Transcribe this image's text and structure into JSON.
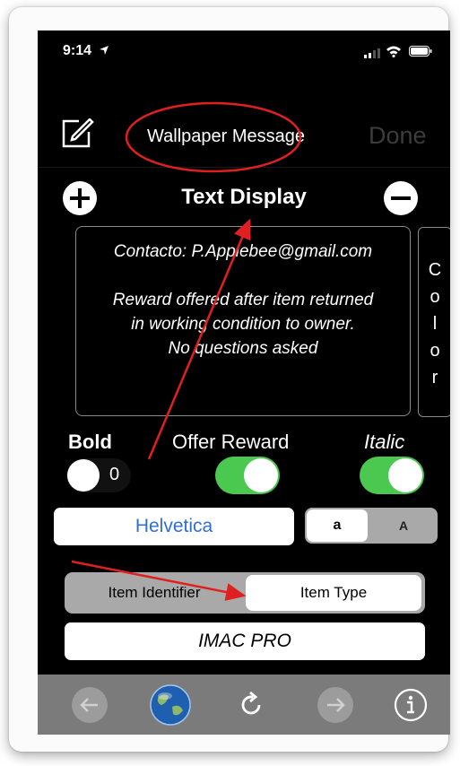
{
  "status_bar": {
    "time": "9:14"
  },
  "nav": {
    "title": "Wallpaper Message",
    "done_label": "Done"
  },
  "section": {
    "title": "Text Display"
  },
  "message": {
    "lines": [
      "Contacto: P.Applebee@gmail.com",
      "",
      "Reward offered after item returned",
      "in working condition to owner.",
      "No questions asked"
    ]
  },
  "color_button": {
    "letters": [
      "C",
      "o",
      "l",
      "o",
      "r"
    ]
  },
  "labels": {
    "bold": "Bold",
    "offer_reward": "Offer Reward",
    "italic": "Italic"
  },
  "bold_toggle": {
    "value": "0",
    "on": false
  },
  "reward_toggle": {
    "on": true
  },
  "italic_toggle": {
    "on": true
  },
  "font": {
    "name": "Helvetica"
  },
  "case_segment": {
    "lower": "a",
    "upper": "A",
    "selected": "lower"
  },
  "type_segment": {
    "identifier_label": "Item Identifier",
    "type_label": "Item Type",
    "selected": "Item Type"
  },
  "item": {
    "value": "IMAC PRO"
  },
  "colors": {
    "accent_blue": "#2f6fd6",
    "toggle_green": "#4bc84f",
    "annotation_red": "#e02020"
  },
  "toolbar": {
    "icons": [
      "back-arrow-icon",
      "globe-icon",
      "reload-icon",
      "forward-arrow-icon",
      "info-icon"
    ]
  }
}
